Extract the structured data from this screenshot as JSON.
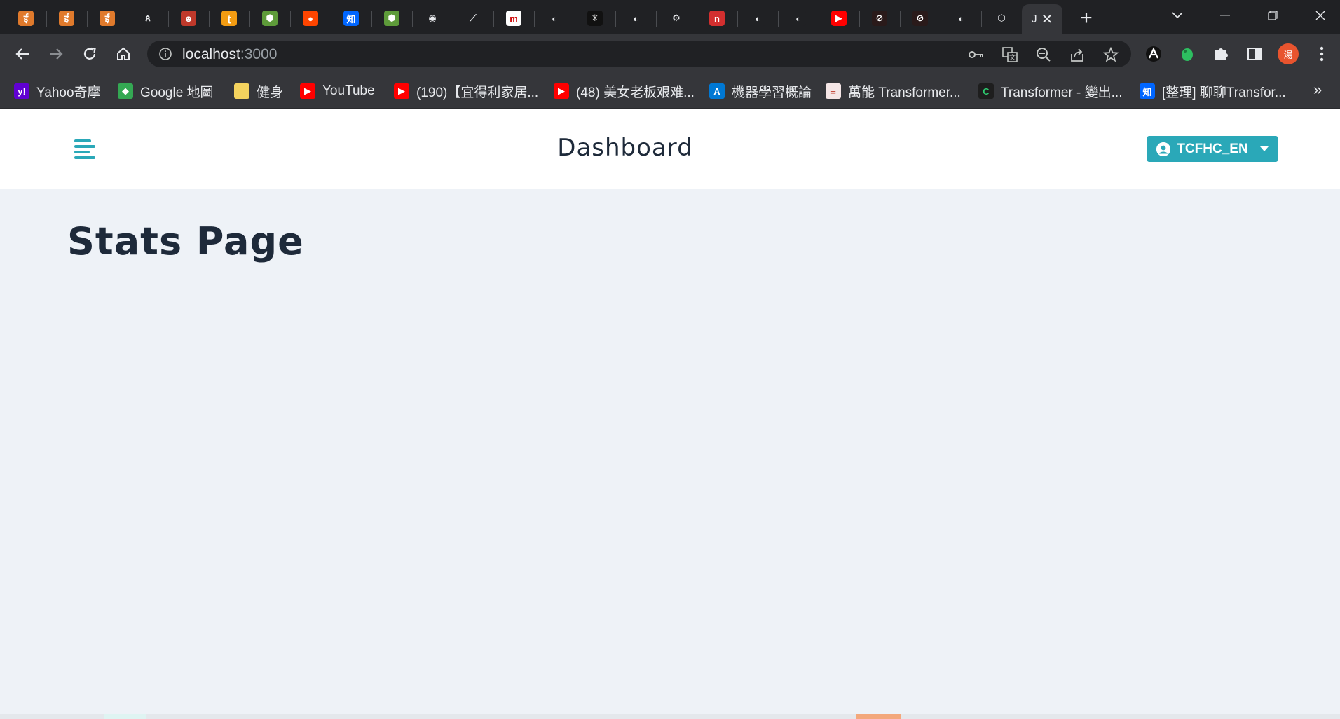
{
  "browser": {
    "tabs": [
      {
        "icon": "ug-flame-icon",
        "color": "#e07a2c",
        "glyph": "ई"
      },
      {
        "icon": "ug-flame-icon",
        "color": "#e07a2c",
        "glyph": "ई"
      },
      {
        "icon": "ug-flame-icon",
        "color": "#e07a2c",
        "glyph": "ई"
      },
      {
        "icon": "stylized-a-icon",
        "color": "#202124",
        "glyph": "ጰ"
      },
      {
        "icon": "anime-avatar-icon",
        "color": "#c0392b",
        "glyph": "☻"
      },
      {
        "icon": "orange-bird-icon",
        "color": "#f39c12",
        "glyph": "ʈ"
      },
      {
        "icon": "green-hex-icon",
        "color": "#5e9b3a",
        "glyph": "⬢"
      },
      {
        "icon": "reddit-icon",
        "color": "#ff4500",
        "glyph": "●"
      },
      {
        "icon": "zhihu-icon",
        "color": "#0066ff",
        "glyph": "知"
      },
      {
        "icon": "green-hex-icon",
        "color": "#5e9b3a",
        "glyph": "⬢"
      },
      {
        "icon": "github-icon",
        "color": "#202124",
        "glyph": "◉"
      },
      {
        "icon": "teal-pen-icon",
        "color": "#202124",
        "glyph": "⟋"
      },
      {
        "icon": "m-logo-icon",
        "color": "#ffffff",
        "glyph": "m"
      },
      {
        "icon": "globe-icon",
        "color": "#202124",
        "glyph": "◐"
      },
      {
        "icon": "spark-icon",
        "color": "#111111",
        "glyph": "✳"
      },
      {
        "icon": "globe-icon",
        "color": "#202124",
        "glyph": "◐"
      },
      {
        "icon": "gear-icon",
        "color": "#202124",
        "glyph": "⚙"
      },
      {
        "icon": "n-logo-icon",
        "color": "#d32f2f",
        "glyph": "n"
      },
      {
        "icon": "globe-icon",
        "color": "#202124",
        "glyph": "◐"
      },
      {
        "icon": "globe-icon",
        "color": "#202124",
        "glyph": "◐"
      },
      {
        "icon": "youtube-icon",
        "color": "#ff0000",
        "glyph": "▶"
      },
      {
        "icon": "dark-compass-icon",
        "color": "#2a1a1a",
        "glyph": "⊘"
      },
      {
        "icon": "dark-compass-icon",
        "color": "#2a1a1a",
        "glyph": "⊘"
      },
      {
        "icon": "globe-icon",
        "color": "#202124",
        "glyph": "◐"
      },
      {
        "icon": "cube-icon",
        "color": "#202124",
        "glyph": "⬡"
      }
    ],
    "active_tab_label": "J",
    "address": {
      "host": "localhost",
      "port": ":3000"
    },
    "bookmarks": [
      {
        "label": "Yahoo奇摩",
        "icon": "yahoo-icon",
        "color": "#6001d2",
        "glyph": "y!"
      },
      {
        "label": "Google 地圖",
        "icon": "google-maps-icon",
        "color": "#34a853",
        "glyph": "◆"
      },
      {
        "label": "健身",
        "icon": "folder-icon",
        "color": "#f4d35e",
        "glyph": ""
      },
      {
        "label": "YouTube",
        "icon": "youtube-icon",
        "color": "#ff0000",
        "glyph": "▶"
      },
      {
        "label": "(190)【宜得利家居...",
        "icon": "youtube-icon",
        "color": "#ff0000",
        "glyph": "▶"
      },
      {
        "label": "(48) 美女老板艰难...",
        "icon": "youtube-icon",
        "color": "#ff0000",
        "glyph": "▶"
      },
      {
        "label": "機器學習概論",
        "icon": "azure-icon",
        "color": "#0078d4",
        "glyph": "A"
      },
      {
        "label": "萬能 Transformer...",
        "icon": "page-icon",
        "color": "#f5e6e6",
        "glyph": "≡"
      },
      {
        "label": "Transformer - 變出...",
        "icon": "c-logo-icon",
        "color": "#1e1e1e",
        "glyph": "C"
      },
      {
        "label": "[整理] 聊聊Transfor...",
        "icon": "zhihu-icon",
        "color": "#0066ff",
        "glyph": "知"
      }
    ],
    "profile_initial": "湯"
  },
  "app": {
    "header_title": "Dashboard",
    "user_button_label": "TCFHC_EN",
    "page_heading": "Stats Page"
  },
  "colors": {
    "accent": "#2aa8b8",
    "page_bg": "#eef2f7",
    "heading_text": "#1e2a3a"
  }
}
